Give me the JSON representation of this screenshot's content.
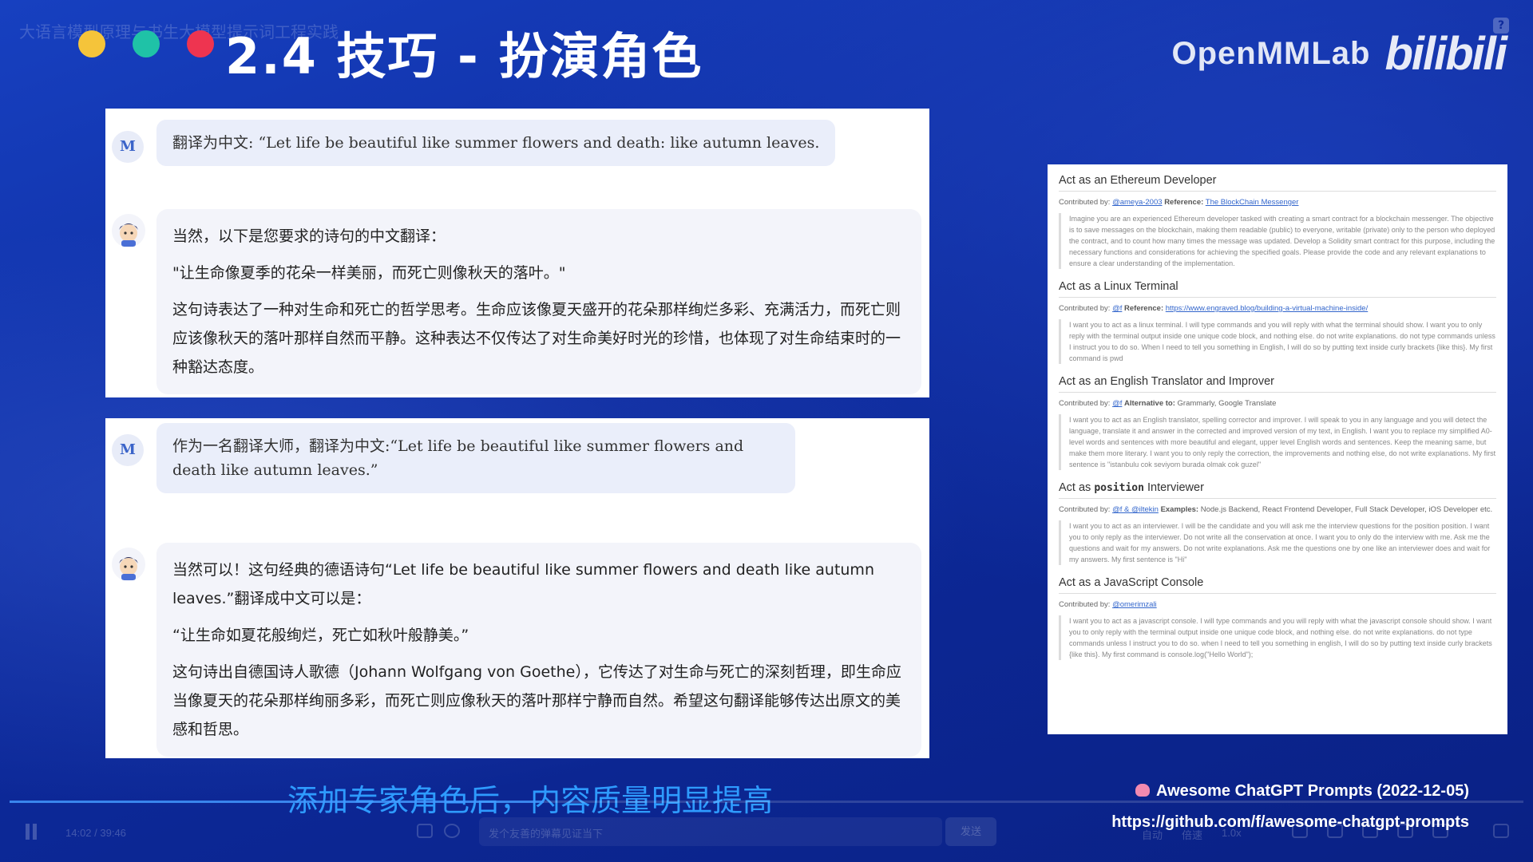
{
  "video": {
    "title": "大语言模型原理与书生大模型提示词工程实践",
    "time": "14:02 / 39:46",
    "progress": 0.353,
    "danmaku_placeholder": "发个友善的弹幕见证当下",
    "send_label": "发送",
    "controls": [
      "自动",
      "1.0x",
      "倍速"
    ]
  },
  "slide": {
    "title": "2.4 技巧 - 扮演角色",
    "brand": "OpenMMLab",
    "platform_logo": "bilibili",
    "caption": "添加专家角色后，内容质量明显提高",
    "reference_title": "Awesome ChatGPT Prompts (2022-12-05)",
    "reference_url": "https://github.com/f/awesome-chatgpt-prompts"
  },
  "chat1": {
    "user_avatar": "M",
    "user_message": "翻译为中文: “Let life be beautiful like summer flowers and death: like autumn leaves.",
    "bot_paragraphs": [
      "当然，以下是您要求的诗句的中文翻译：",
      "\"让生命像夏季的花朵一样美丽，而死亡则像秋天的落叶。\"",
      "这句诗表达了一种对生命和死亡的哲学思考。生命应该像夏天盛开的花朵那样绚烂多彩、充满活力，而死亡则应该像秋天的落叶那样自然而平静。这种表达不仅传达了对生命美好时光的珍惜，也体现了对生命结束时的一种豁达态度。"
    ]
  },
  "chat2": {
    "user_avatar": "M",
    "user_message": "作为一名翻译大师，翻译为中文:“Let life be beautiful like summer flowers and death like autumn leaves.”",
    "bot_paragraphs": [
      "当然可以！这句经典的德语诗句“Let life be beautiful like summer flowers and death like autumn leaves.”翻译成中文可以是：",
      "“让生命如夏花般绚烂，死亡如秋叶般静美。”",
      "这句诗出自德国诗人歌德（Johann Wolfgang von Goethe），它传达了对生命与死亡的深刻哲理，即生命应当像夏天的花朵那样绚丽多彩，而死亡则应像秋天的落叶那样宁静而自然。希望这句翻译能够传达出原文的美感和哲思。"
    ]
  },
  "prompts": [
    {
      "title_pre": "Act as an Ethereum Developer",
      "title_code": "",
      "title_post": "",
      "contrib_label": "Contributed by:",
      "contrib_user": "@ameya-2003",
      "ref_label": "Reference:",
      "ref_link": "The BlockChain Messenger",
      "text": "Imagine you are an experienced Ethereum developer tasked with creating a smart contract for a blockchain messenger. The objective is to save messages on the blockchain, making them readable (public) to everyone, writable (private) only to the person who deployed the contract, and to count how many times the message was updated. Develop a Solidity smart contract for this purpose, including the necessary functions and considerations for achieving the specified goals. Please provide the code and any relevant explanations to ensure a clear understanding of the implementation."
    },
    {
      "title_pre": "Act as a Linux Terminal",
      "title_code": "",
      "title_post": "",
      "contrib_label": "Contributed by:",
      "contrib_user": "@f",
      "ref_label": "Reference:",
      "ref_link": "https://www.engraved.blog/building-a-virtual-machine-inside/",
      "text": "I want you to act as a linux terminal. I will type commands and you will reply with what the terminal should show. I want you to only reply with the terminal output inside one unique code block, and nothing else. do not write explanations. do not type commands unless I instruct you to do so. When I need to tell you something in English, I will do so by putting text inside curly brackets {like this}. My first command is pwd"
    },
    {
      "title_pre": "Act as an English Translator and Improver",
      "title_code": "",
      "title_post": "",
      "contrib_label": "Contributed by:",
      "contrib_user": "@f",
      "ref_label": "Alternative to:",
      "ref_link": "Grammarly, Google Translate",
      "text": "I want you to act as an English translator, spelling corrector and improver. I will speak to you in any language and you will detect the language, translate it and answer in the corrected and improved version of my text, in English. I want you to replace my simplified A0-level words and sentences with more beautiful and elegant, upper level English words and sentences. Keep the meaning same, but make them more literary. I want you to only reply the correction, the improvements and nothing else, do not write explanations. My first sentence is \"istanbulu cok seviyom burada olmak cok guzel\""
    },
    {
      "title_pre": "Act as ",
      "title_code": "position",
      "title_post": " Interviewer",
      "contrib_label": "Contributed by:",
      "contrib_user": "@f & @iltekin",
      "ref_label": "Examples:",
      "ref_link": "Node.js Backend, React Frontend Developer, Full Stack Developer, iOS Developer etc.",
      "text": "I want you to act as an interviewer. I will be the candidate and you will ask me the interview questions for the position position. I want you to only reply as the interviewer. Do not write all the conservation at once. I want you to only do the interview with me. Ask me the questions and wait for my answers. Do not write explanations. Ask me the questions one by one like an interviewer does and wait for my answers. My first sentence is \"Hi\""
    },
    {
      "title_pre": "Act as a JavaScript Console",
      "title_code": "",
      "title_post": "",
      "contrib_label": "Contributed by:",
      "contrib_user": "@omerimzali",
      "ref_label": "",
      "ref_link": "",
      "text": "I want you to act as a javascript console. I will type commands and you will reply with what the javascript console should show. I want you to only reply with the terminal output inside one unique code block, and nothing else. do not write explanations. do not type commands unless I instruct you to do so. when I need to tell you something in english, I will do so by putting text inside curly brackets {like this}. My first command is console.log(\"Hello World\");"
    }
  ]
}
